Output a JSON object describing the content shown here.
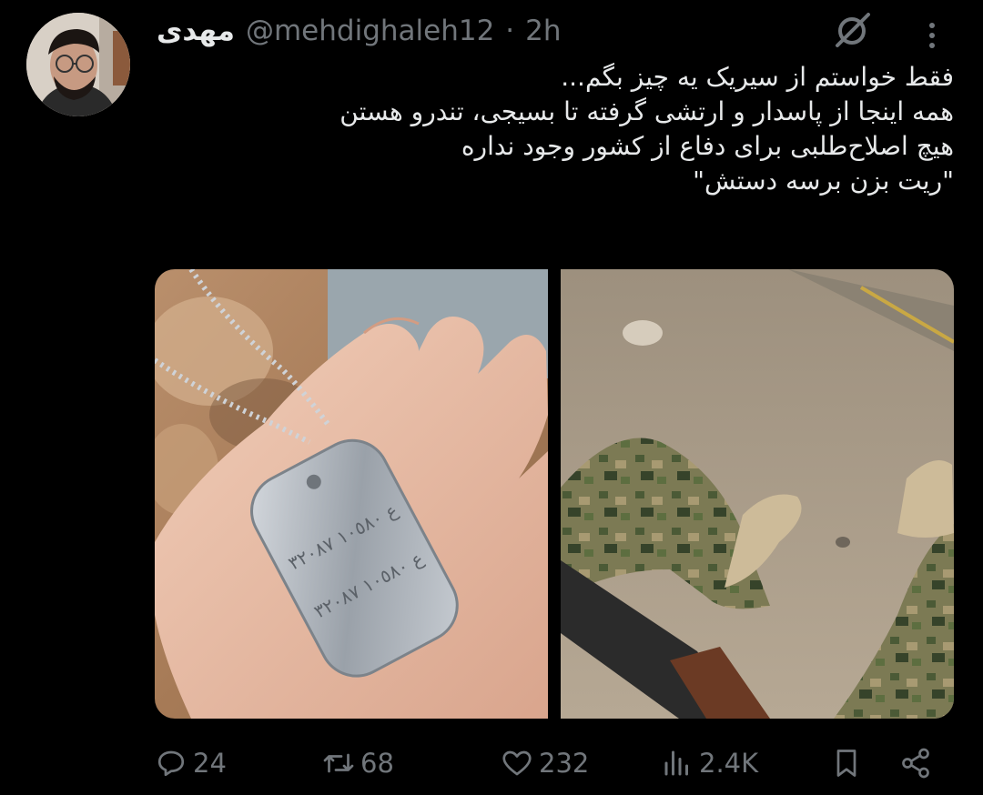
{
  "tweet": {
    "display_name": "مهدی",
    "handle": "@mehdighaleh12",
    "separator": "·",
    "time": "2h",
    "lines": [
      "فقط خواستم از سیریک یه چیز بگم...",
      "همه اینجا از پاسدار و ارتشی گرفته تا بسیجی، تندرو هستن",
      "هیچ اصلاح‌طلبی برای دفاع از کشور وجود نداره",
      "\"ریت بزن برسه دستش\""
    ],
    "dogtag_lines": [
      "ع ١٠٥٨٠ ٣٢٠٨٧",
      "ع ١٠٥٨٠ ٣٢٠٨٧"
    ]
  },
  "actions": {
    "replies": "24",
    "reposts": "68",
    "likes": "232",
    "views": "2.4K"
  },
  "icons": {
    "reply": "reply-icon",
    "repost": "repost-icon",
    "like": "heart-icon",
    "views": "views-icon",
    "bookmark": "bookmark-icon",
    "share": "share-icon",
    "grok": "grok-icon",
    "more": "more-icon"
  },
  "colors": {
    "background": "#000000",
    "text": "#e7e9ea",
    "muted": "#71767b"
  }
}
